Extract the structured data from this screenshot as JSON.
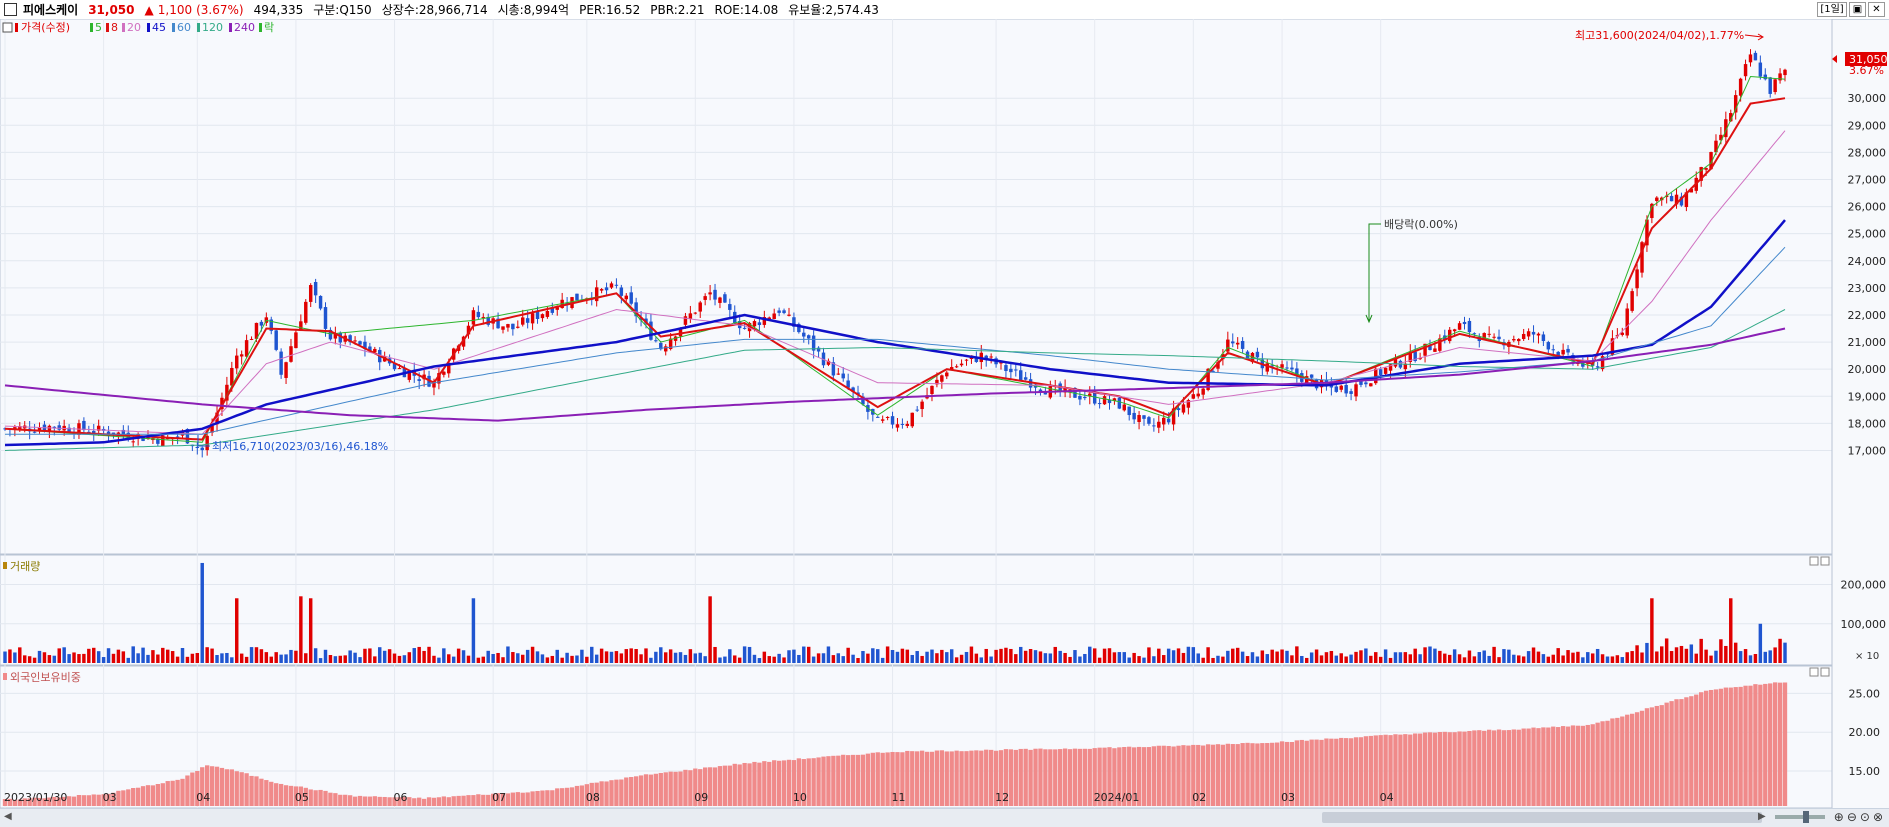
{
  "header": {
    "stock_name": "피에스케이",
    "price": "31,050",
    "change_arrow": "▲",
    "change": "1,100",
    "change_pct": "(3.67%)",
    "volume": "494,335",
    "category": "구분:Q150",
    "shares": "상장수:28,966,714",
    "market_cap": "시총:8,994억",
    "per": "PER:16.52",
    "pbr": "PBR:2.21",
    "roe": "ROE:14.08",
    "retention": "유보율:2,574.43",
    "period": "[1일]"
  },
  "legend": {
    "price_label": "가격(수정)",
    "ma_labels": [
      "5",
      "8",
      "20",
      "45",
      "60",
      "120",
      "240"
    ],
    "ex_label": "락"
  },
  "colors": {
    "up": "#e00000",
    "down": "#1f55d0",
    "ma5": "#2db52d",
    "ma8": "#dd1111",
    "ma20": "#d070c0",
    "ma45": "#1010c8",
    "ma60": "#4488cc",
    "ma120": "#33aa88",
    "ma240": "#8a1fb5",
    "foreign": "#f08a8a"
  },
  "annotations": {
    "high": "최고31,600(2024/04/02),1.77%",
    "low": "최저16,710(2023/03/16),46.18%",
    "dividend": "배당락(0.00%)",
    "last_price_tag": "31,050",
    "last_pct_tag": "3.67%"
  },
  "panes": {
    "volume_title": "거래량",
    "volume_unit": "× 10",
    "foreign_title": "외국인보유비중"
  },
  "chart_data": [
    {
      "type": "candlestick",
      "title": "",
      "y_ticks": [
        "17,000",
        "18,000",
        "19,000",
        "20,000",
        "21,000",
        "22,000",
        "23,000",
        "24,000",
        "25,000",
        "26,000",
        "27,000",
        "28,000",
        "29,000",
        "30,000"
      ],
      "ylim": [
        16500,
        32000
      ],
      "x_labels": [
        "2023/01/30",
        "03",
        "04",
        "05",
        "06",
        "07",
        "08",
        "09",
        "10",
        "11",
        "12",
        "2024/01",
        "02",
        "03",
        "04"
      ],
      "closes_keypoints": [
        [
          0,
          17800
        ],
        [
          10,
          17900
        ],
        [
          20,
          17700
        ],
        [
          28,
          17500
        ],
        [
          33,
          17400
        ],
        [
          36,
          17600
        ],
        [
          40,
          17000
        ],
        [
          43,
          18400
        ],
        [
          47,
          20500
        ],
        [
          53,
          22000
        ],
        [
          56,
          19800
        ],
        [
          62,
          23000
        ],
        [
          66,
          21200
        ],
        [
          73,
          20800
        ],
        [
          80,
          20000
        ],
        [
          87,
          19500
        ],
        [
          95,
          22000
        ],
        [
          103,
          21500
        ],
        [
          113,
          22500
        ],
        [
          124,
          23000
        ],
        [
          133,
          20800
        ],
        [
          143,
          22800
        ],
        [
          150,
          21500
        ],
        [
          157,
          22200
        ],
        [
          163,
          21000
        ],
        [
          170,
          19500
        ],
        [
          177,
          18000
        ],
        [
          183,
          18100
        ],
        [
          191,
          20000
        ],
        [
          198,
          20500
        ],
        [
          205,
          19800
        ],
        [
          212,
          19200
        ],
        [
          219,
          19000
        ],
        [
          226,
          18700
        ],
        [
          232,
          17800
        ],
        [
          236,
          18200
        ],
        [
          242,
          19200
        ],
        [
          248,
          21000
        ],
        [
          255,
          20200
        ],
        [
          262,
          19800
        ],
        [
          268,
          19300
        ],
        [
          273,
          19300
        ],
        [
          280,
          20000
        ],
        [
          287,
          20600
        ],
        [
          295,
          21600
        ],
        [
          302,
          21000
        ],
        [
          310,
          21300
        ],
        [
          317,
          20400
        ],
        [
          322,
          20000
        ],
        [
          328,
          21400
        ],
        [
          334,
          26300
        ],
        [
          340,
          26200
        ],
        [
          346,
          27800
        ],
        [
          350,
          29500
        ],
        [
          354,
          31600
        ],
        [
          358,
          30300
        ],
        [
          361,
          31050
        ]
      ],
      "series": [
        {
          "name": "5",
          "keypoints": [
            [
              0,
              17800
            ],
            [
              40,
              17300
            ],
            [
              53,
              21800
            ],
            [
              66,
              21300
            ],
            [
              95,
              21800
            ],
            [
              124,
              22800
            ],
            [
              133,
              21000
            ],
            [
              150,
              21800
            ],
            [
              177,
              18300
            ],
            [
              191,
              20000
            ],
            [
              226,
              18800
            ],
            [
              236,
              18200
            ],
            [
              248,
              20800
            ],
            [
              268,
              19400
            ],
            [
              295,
              21400
            ],
            [
              322,
              20100
            ],
            [
              334,
              26000
            ],
            [
              346,
              27600
            ],
            [
              354,
              30800
            ],
            [
              361,
              30700
            ]
          ]
        },
        {
          "name": "8",
          "keypoints": [
            [
              0,
              17800
            ],
            [
              40,
              17400
            ],
            [
              53,
              21500
            ],
            [
              66,
              21400
            ],
            [
              87,
              19500
            ],
            [
              95,
              21600
            ],
            [
              124,
              22800
            ],
            [
              133,
              21200
            ],
            [
              150,
              21700
            ],
            [
              177,
              18600
            ],
            [
              191,
              20000
            ],
            [
              226,
              19000
            ],
            [
              236,
              18300
            ],
            [
              248,
              20600
            ],
            [
              268,
              19400
            ],
            [
              295,
              21300
            ],
            [
              322,
              20200
            ],
            [
              334,
              25200
            ],
            [
              346,
              27400
            ],
            [
              354,
              29800
            ],
            [
              361,
              30000
            ]
          ]
        },
        {
          "name": "20",
          "keypoints": [
            [
              0,
              17900
            ],
            [
              40,
              17600
            ],
            [
              53,
              20200
            ],
            [
              66,
              21000
            ],
            [
              87,
              20000
            ],
            [
              124,
              22200
            ],
            [
              150,
              21600
            ],
            [
              177,
              19500
            ],
            [
              212,
              19400
            ],
            [
              236,
              18700
            ],
            [
              268,
              19500
            ],
            [
              295,
              20800
            ],
            [
              322,
              20300
            ],
            [
              334,
              22500
            ],
            [
              346,
              25500
            ],
            [
              361,
              28800
            ]
          ]
        },
        {
          "name": "45",
          "keypoints": [
            [
              0,
              17200
            ],
            [
              20,
              17300
            ],
            [
              40,
              17800
            ],
            [
              53,
              18700
            ],
            [
              87,
              20100
            ],
            [
              124,
              21000
            ],
            [
              150,
              22000
            ],
            [
              177,
              21000
            ],
            [
              212,
              20000
            ],
            [
              236,
              19500
            ],
            [
              268,
              19400
            ],
            [
              295,
              20200
            ],
            [
              322,
              20500
            ],
            [
              334,
              20900
            ],
            [
              346,
              22300
            ],
            [
              361,
              25500
            ]
          ]
        },
        {
          "name": "60",
          "keypoints": [
            [
              0,
              17600
            ],
            [
              40,
              17600
            ],
            [
              87,
              19500
            ],
            [
              124,
              20600
            ],
            [
              150,
              21100
            ],
            [
              177,
              21100
            ],
            [
              212,
              20500
            ],
            [
              236,
              20000
            ],
            [
              268,
              19600
            ],
            [
              295,
              19900
            ],
            [
              322,
              20300
            ],
            [
              346,
              21600
            ],
            [
              361,
              24500
            ]
          ]
        },
        {
          "name": "120",
          "keypoints": [
            [
              0,
              17000
            ],
            [
              40,
              17200
            ],
            [
              87,
              18500
            ],
            [
              124,
              19800
            ],
            [
              150,
              20700
            ],
            [
              177,
              20800
            ],
            [
              212,
              20600
            ],
            [
              236,
              20500
            ],
            [
              268,
              20300
            ],
            [
              295,
              20100
            ],
            [
              322,
              20000
            ],
            [
              346,
              20800
            ],
            [
              361,
              22200
            ]
          ]
        },
        {
          "name": "240",
          "keypoints": [
            [
              0,
              19400
            ],
            [
              40,
              18700
            ],
            [
              70,
              18300
            ],
            [
              100,
              18100
            ],
            [
              130,
              18500
            ],
            [
              160,
              18800
            ],
            [
              200,
              19100
            ],
            [
              236,
              19300
            ],
            [
              268,
              19500
            ],
            [
              295,
              19800
            ],
            [
              322,
              20300
            ],
            [
              346,
              20900
            ],
            [
              361,
              21500
            ]
          ]
        }
      ]
    },
    {
      "type": "bar",
      "title": "",
      "y_ticks": [
        "100,000",
        "200,000"
      ],
      "ylim": [
        0,
        260000
      ],
      "spikes": [
        [
          40,
          255000
        ],
        [
          47,
          165000
        ],
        [
          60,
          170000
        ],
        [
          62,
          165000
        ],
        [
          95,
          165000
        ],
        [
          143,
          170000
        ],
        [
          334,
          165000
        ],
        [
          350,
          165000
        ],
        [
          356,
          100000
        ]
      ],
      "baseline": 25000
    },
    {
      "type": "bar",
      "title": "",
      "y_ticks": [
        "15.00",
        "20.00",
        "25.00"
      ],
      "ylim": [
        10.5,
        27.5
      ],
      "keypoints": [
        [
          0,
          11.3
        ],
        [
          20,
          12.0
        ],
        [
          36,
          14.0
        ],
        [
          41,
          15.8
        ],
        [
          47,
          15.0
        ],
        [
          55,
          13.5
        ],
        [
          70,
          11.8
        ],
        [
          85,
          11.5
        ],
        [
          110,
          12.5
        ],
        [
          130,
          14.5
        ],
        [
          150,
          16.0
        ],
        [
          180,
          17.5
        ],
        [
          210,
          17.8
        ],
        [
          236,
          18.2
        ],
        [
          260,
          18.8
        ],
        [
          285,
          19.8
        ],
        [
          310,
          20.5
        ],
        [
          322,
          21.0
        ],
        [
          334,
          23.2
        ],
        [
          346,
          25.5
        ],
        [
          361,
          26.5
        ]
      ]
    }
  ]
}
